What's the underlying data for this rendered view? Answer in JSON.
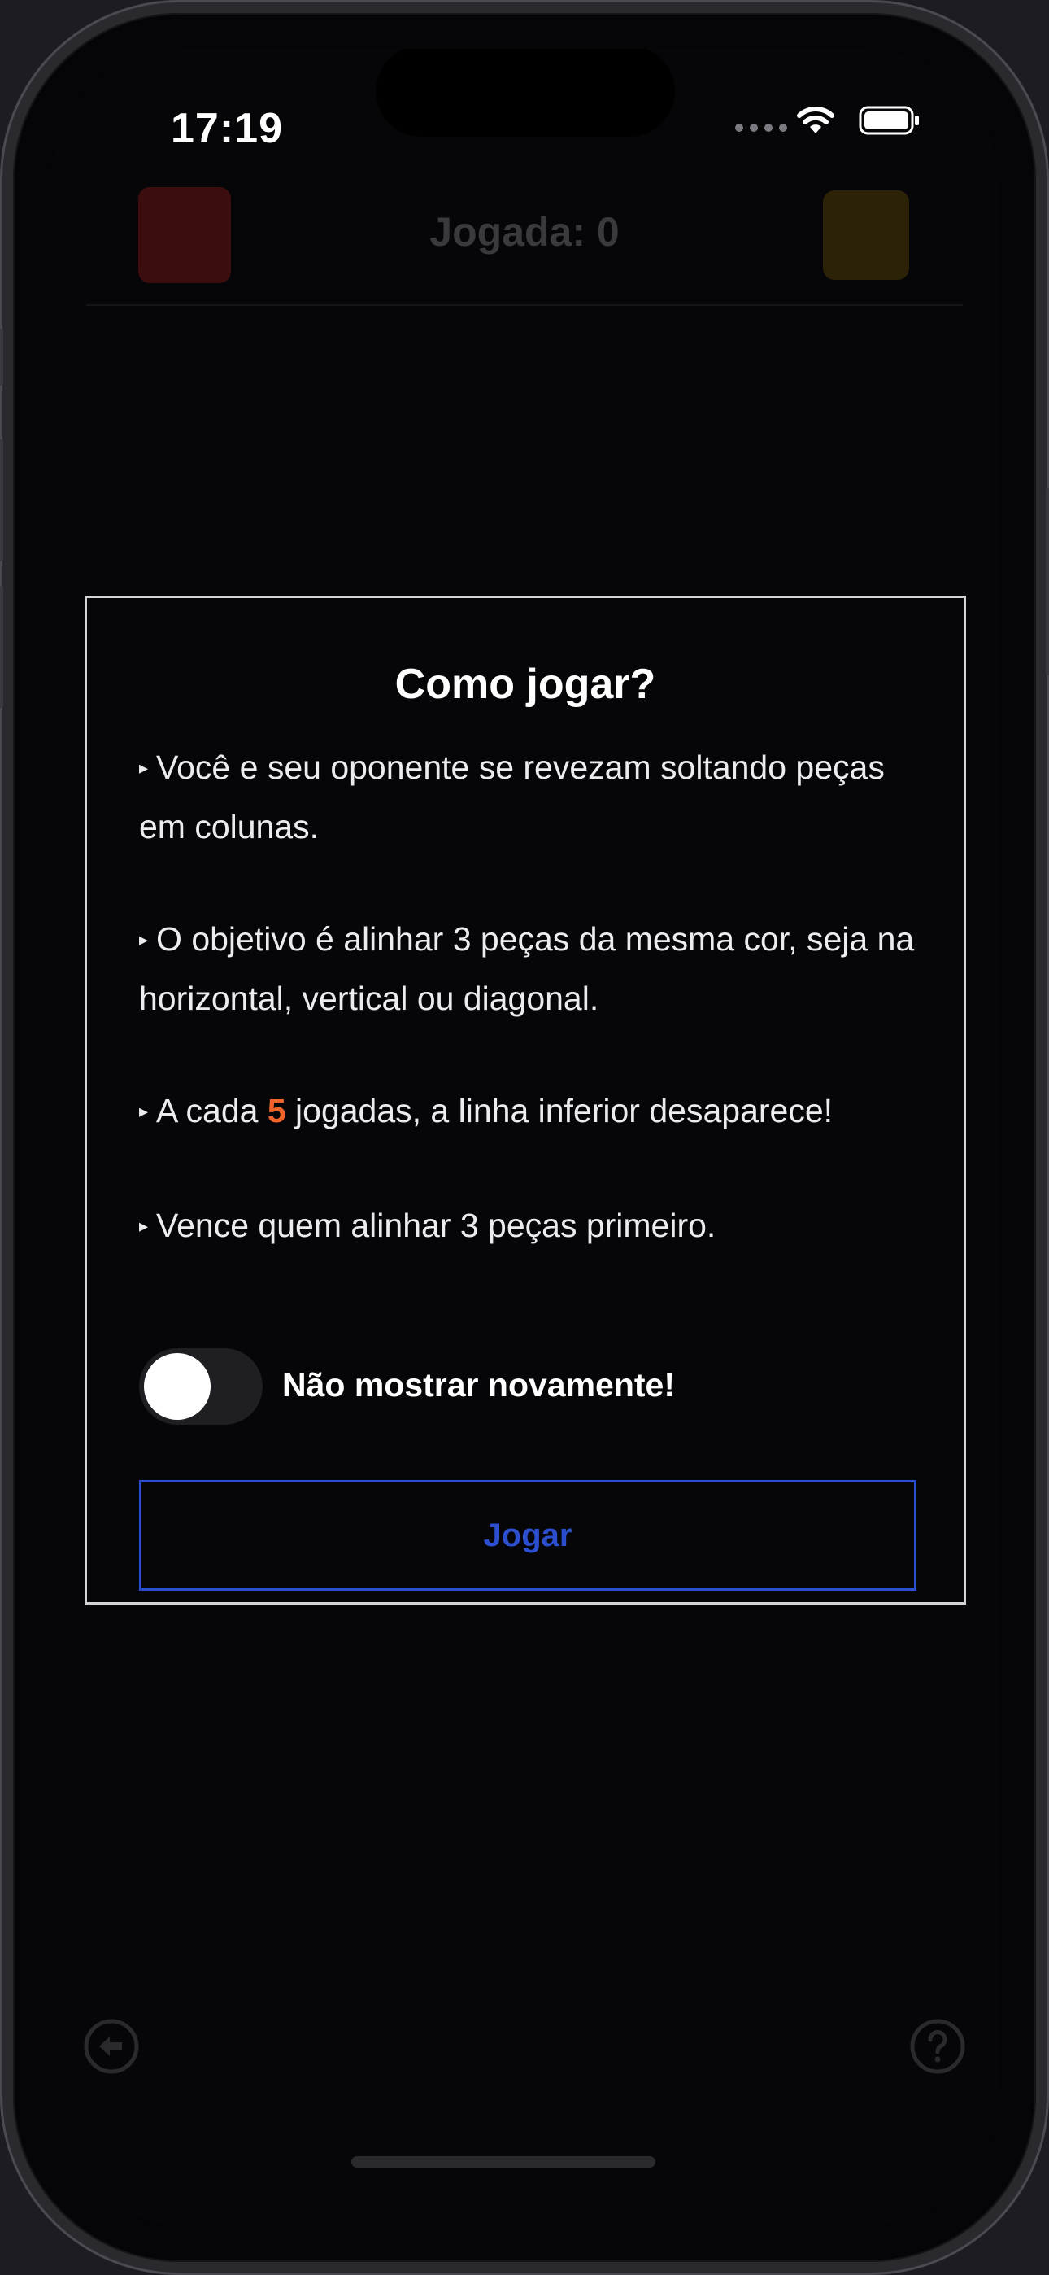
{
  "status_bar": {
    "time": "17:19"
  },
  "game_header": {
    "move_counter": "Jogada: 0",
    "player1_color": "#3b0d0f",
    "player2_color": "#2b2208"
  },
  "modal": {
    "title": "Como jogar?",
    "rules": [
      {
        "text": "Você e seu oponente se revezam soltando peças em colunas."
      },
      {
        "text": "O objetivo é alinhar 3 peças da mesma cor, seja na horizontal, vertical ou diagonal."
      },
      {
        "prefix": "A cada ",
        "highlight": "5",
        "suffix": " jogadas, a linha inferior desaparece!"
      },
      {
        "text": "Vence quem alinhar 3 peças primeiro."
      }
    ],
    "bullet_glyph": "▸",
    "toggle_label": "Não mostrar novamente!",
    "toggle_on": false,
    "play_button_label": "Jogar"
  },
  "icons": {
    "back": "back-arrow-circle-icon",
    "help": "question-circle-icon",
    "wifi": "wifi-icon",
    "battery": "battery-icon"
  },
  "colors": {
    "accent_blue": "#2c4fcf",
    "highlight_orange": "#f0632b",
    "modal_border": "#d4d4d8"
  }
}
